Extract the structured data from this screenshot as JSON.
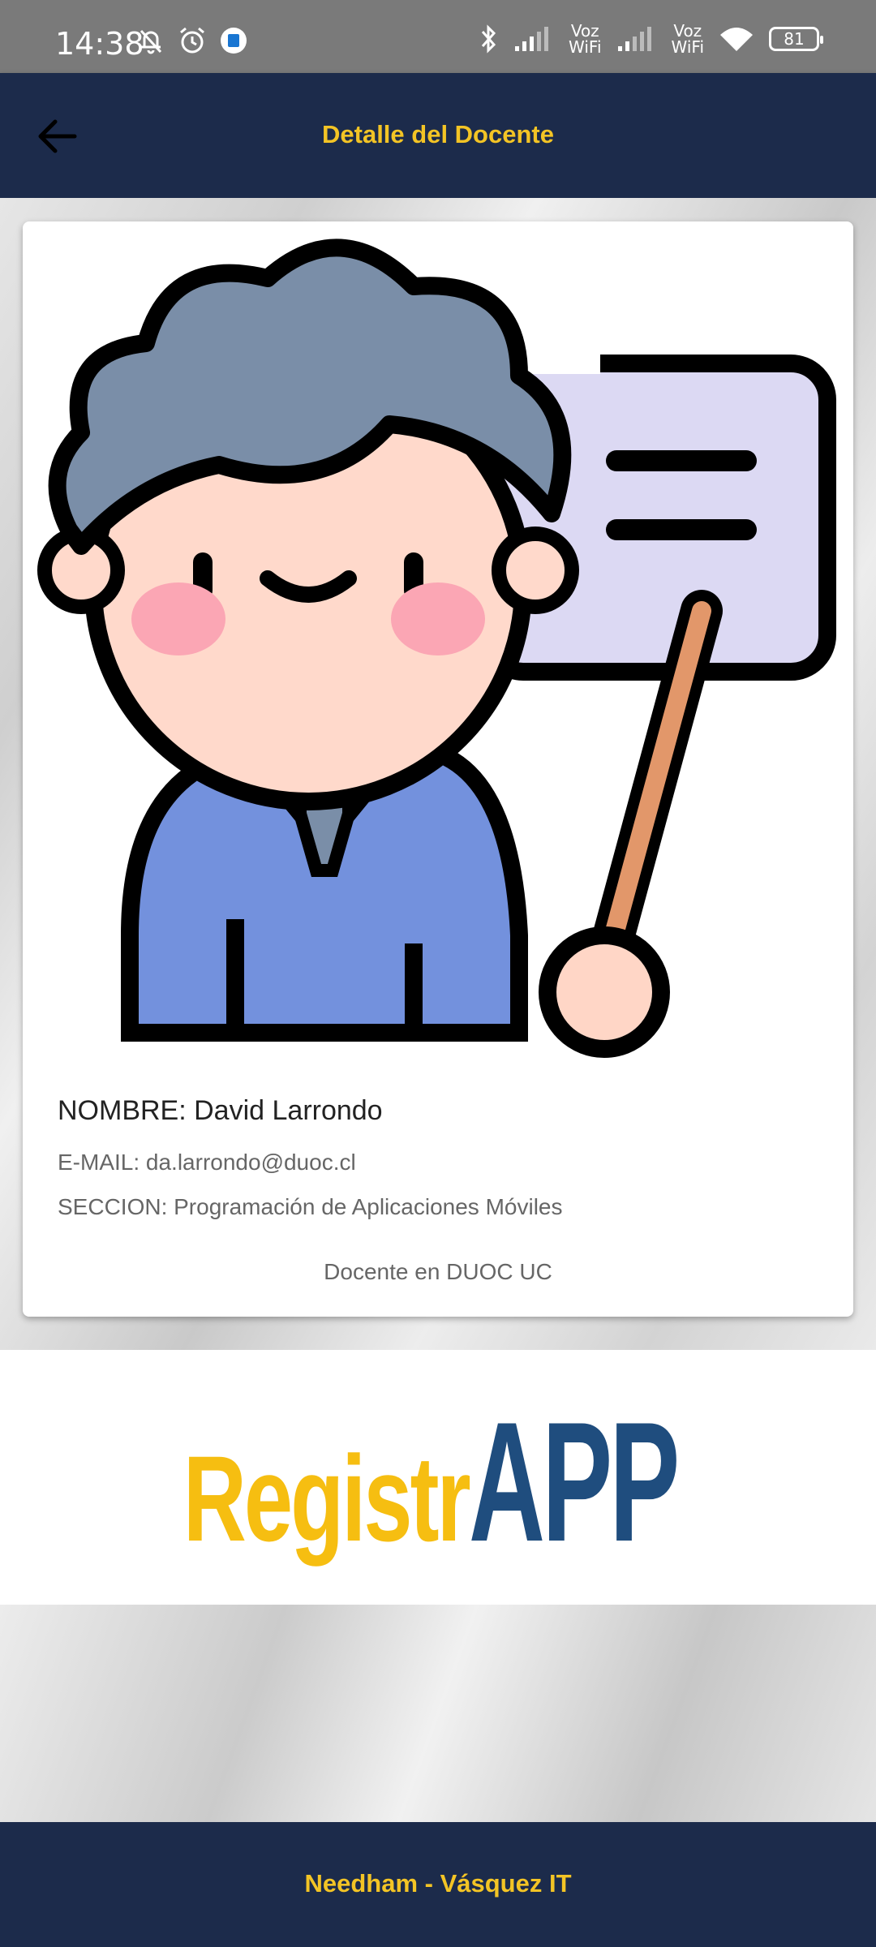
{
  "status_bar": {
    "time": "14:38",
    "battery": "81",
    "voz_wifi_1": "Voz\nWiFi",
    "voz_wifi_2": "Voz\nWiFi"
  },
  "app_bar": {
    "title": "Detalle del Docente"
  },
  "teacher": {
    "name": "NOMBRE: David Larrondo",
    "email": "E-MAIL: da.larrondo@duoc.cl",
    "section": "SECCION: Programación de Aplicaciones Móviles",
    "note": "Docente en DUOC UC"
  },
  "logo": {
    "part1": "Registr",
    "part2": "APP"
  },
  "footer": {
    "text": "Needham - Vásquez IT"
  },
  "colors": {
    "navy": "#1c2b4b",
    "gold": "#f3c425",
    "logo_blue": "#1f4d7e"
  }
}
